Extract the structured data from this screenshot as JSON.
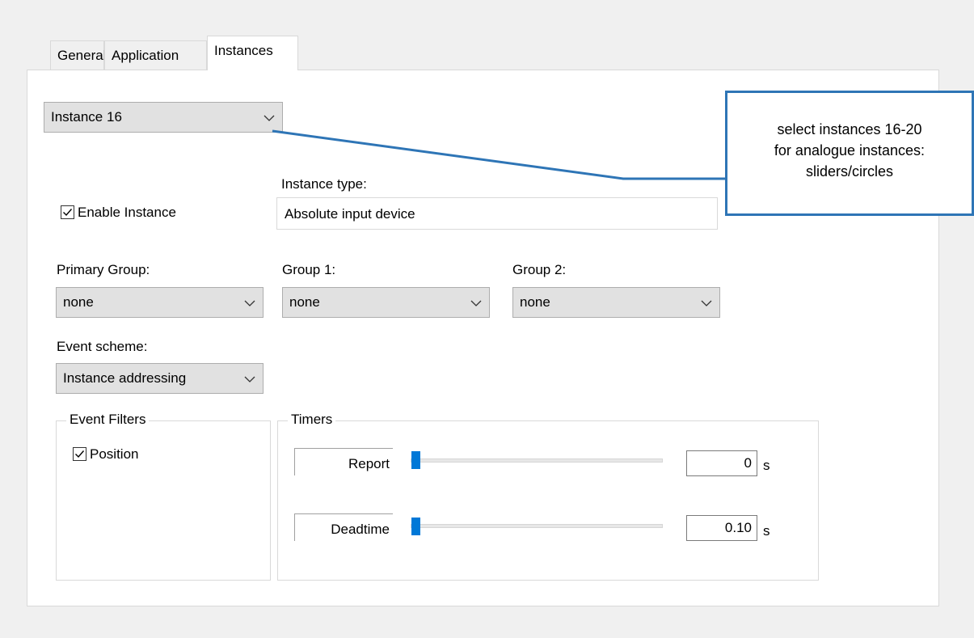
{
  "tabs": [
    {
      "label": "General"
    },
    {
      "label": "Application"
    },
    {
      "label": "Instances"
    }
  ],
  "instance_select": {
    "value": "Instance 16"
  },
  "callout": {
    "line1": "select instances 16-20",
    "line2": "for analogue instances:",
    "line3": "sliders/circles"
  },
  "enable_instance": {
    "label": "Enable Instance",
    "checked": true
  },
  "instance_type": {
    "label": "Instance type:",
    "value": "Absolute input device"
  },
  "primary_group": {
    "label": "Primary Group:",
    "value": "none"
  },
  "group1": {
    "label": "Group 1:",
    "value": "none"
  },
  "group2": {
    "label": "Group 2:",
    "value": "none"
  },
  "event_scheme": {
    "label": "Event scheme:",
    "value": "Instance addressing"
  },
  "event_filters": {
    "title": "Event Filters",
    "position_label": "Position",
    "position_checked": true
  },
  "timers": {
    "title": "Timers",
    "report": {
      "label": "Report",
      "value": "0",
      "unit": "s",
      "slider_level": 0
    },
    "deadtime": {
      "label": "Deadtime",
      "value": "0.10",
      "unit": "s",
      "slider_level": 0
    }
  },
  "colors": {
    "accent": "#0078d7",
    "callout_border": "#2e75b6"
  }
}
